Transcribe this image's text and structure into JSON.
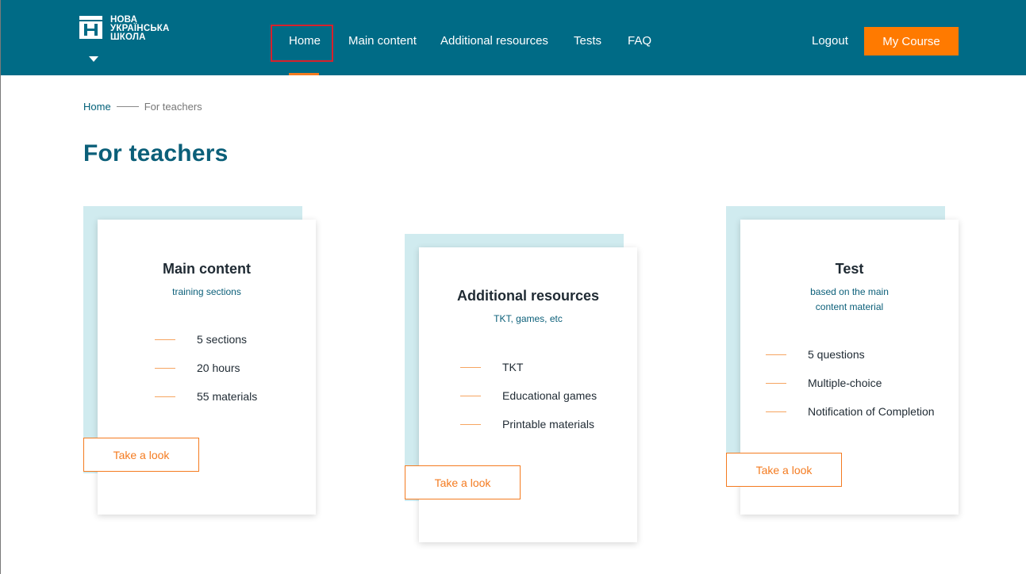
{
  "brand": {
    "logo_lines": [
      "НОВА",
      "УКРАЇНСЬКА",
      "ШКОЛА"
    ]
  },
  "nav": {
    "items": [
      "Home",
      "Main content",
      "Additional resources",
      "Tests",
      "FAQ"
    ],
    "logout": "Logout",
    "my_course": "My Course"
  },
  "breadcrumb": {
    "home": "Home",
    "current": "For teachers"
  },
  "page": {
    "title": "For teachers"
  },
  "cards": [
    {
      "title": "Main content",
      "subtitle": "training sections",
      "features": [
        "5 sections",
        "20 hours",
        "55 materials"
      ],
      "button": "Take a look"
    },
    {
      "title": "Additional resources",
      "subtitle": "TKT, games, etc",
      "features": [
        "TKT",
        "Educational games",
        "Printable materials"
      ],
      "button": "Take a look"
    },
    {
      "title": "Test",
      "subtitle": "based on the main content material",
      "features": [
        "5 questions",
        "Multiple-choice",
        "Notification of Completion"
      ],
      "button": "Take a look"
    }
  ],
  "colors": {
    "header": "#006b86",
    "accent": "#ff7a00",
    "title": "#0b5f79",
    "card_backdrop": "#d0ebef"
  }
}
